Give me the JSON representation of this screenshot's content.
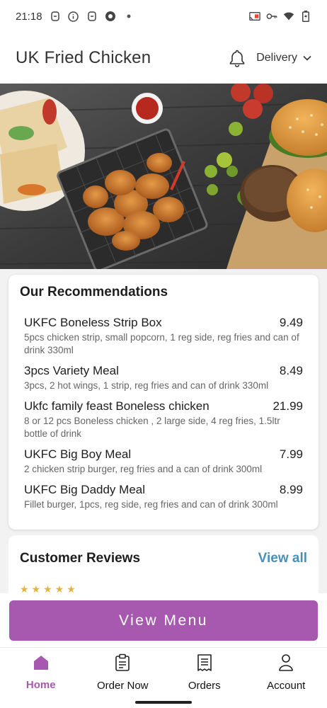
{
  "status_bar": {
    "time": "21:18",
    "left_icons": [
      "sim-icon",
      "info-icon",
      "sim-icon",
      "chrome-icon",
      "dot-icon"
    ],
    "right_icons": [
      "cast-icon",
      "vpn-key-icon",
      "wifi-icon",
      "battery-icon"
    ]
  },
  "header": {
    "title": "UK Fried Chicken",
    "bell_icon": "bell-icon",
    "delivery_label": "Delivery"
  },
  "recommendations": {
    "title": "Our Recommendations",
    "items": [
      {
        "name": "UKFC Boneless Strip Box",
        "price": "9.49",
        "desc": "5pcs chicken strip, small popcorn, 1 reg side, reg fries and can of drink 330ml"
      },
      {
        "name": "3pcs Variety Meal",
        "price": "8.49",
        "desc": "3pcs, 2 hot wings, 1 strip, reg fries and can of drink 330ml"
      },
      {
        "name": "Ukfc family feast Boneless chicken",
        "price": "21.99",
        "desc": "8 or 12 pcs Boneless chicken , 2 large side, 4 reg fries, 1.5ltr bottle of drink"
      },
      {
        "name": "UKFC Big Boy Meal",
        "price": "7.99",
        "desc": "2 chicken strip burger, reg fries and a can of drink 300ml"
      },
      {
        "name": "UKFC Big Daddy Meal",
        "price": "8.99",
        "desc": "Fillet burger, 1pcs, reg side, reg fries and can of drink 300ml"
      }
    ]
  },
  "reviews": {
    "title": "Customer Reviews",
    "view_all": "View all"
  },
  "view_menu_label": "View Menu",
  "nav": [
    {
      "label": "Home",
      "icon": "home-icon",
      "active": true
    },
    {
      "label": "Order Now",
      "icon": "order-icon",
      "active": false
    },
    {
      "label": "Orders",
      "icon": "receipt-icon",
      "active": false
    },
    {
      "label": "Account",
      "icon": "person-icon",
      "active": false
    }
  ],
  "colors": {
    "accent": "#a659ae",
    "link": "#4a8fb8",
    "star": "#e4b43a"
  }
}
